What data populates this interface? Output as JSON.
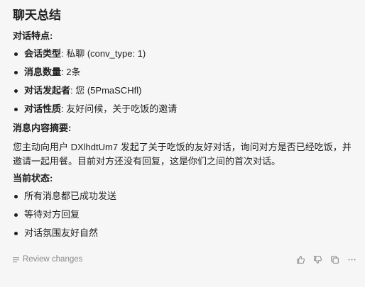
{
  "message": {
    "title": "聊天总结",
    "sections": {
      "features": {
        "heading": "对话特点:",
        "items": [
          {
            "key": "会话类型",
            "value": ": 私聊 (conv_type: 1)"
          },
          {
            "key": "消息数量",
            "value": ": 2条"
          },
          {
            "key": "对话发起者",
            "value": ": 您 (5PmaSCHfl)"
          },
          {
            "key": "对话性质",
            "value": ": 友好问候，关于吃饭的邀请"
          }
        ]
      },
      "summary": {
        "heading": "消息内容摘要:",
        "text": "您主动向用户 DXlhdtUm7 发起了关于吃饭的友好对话，询问对方是否已经吃饭，并邀请一起用餐。目前对方还没有回复，这是你们之间的首次对话。"
      },
      "status": {
        "heading": "当前状态:",
        "items": [
          "所有消息都已成功发送",
          "等待对方回复",
          "对话氛围友好自然"
        ]
      }
    }
  },
  "footer": {
    "review_label": "Review changes",
    "icons": [
      "thumbs-up-icon",
      "thumbs-down-icon",
      "copy-icon",
      "more-icon"
    ]
  },
  "colors": {
    "background": "#f6f6f6",
    "text": "#1f1f1f",
    "muted": "#8a8a8a"
  }
}
